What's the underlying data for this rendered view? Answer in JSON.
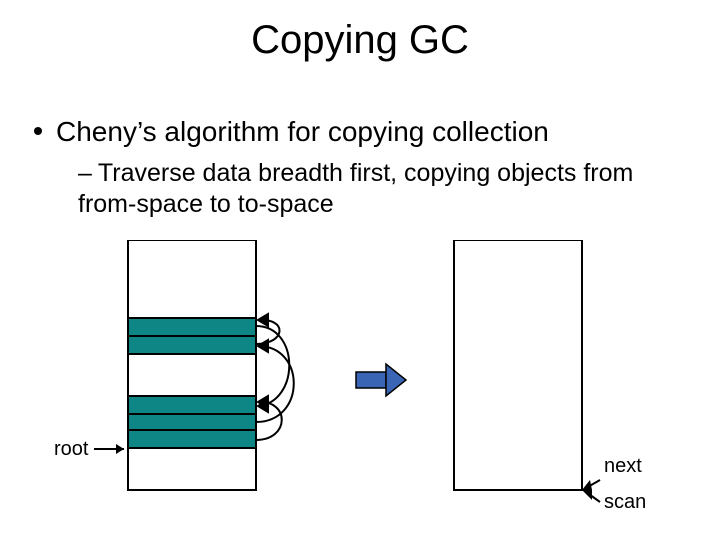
{
  "title": "Copying GC",
  "bullet_main": "Cheny’s algorithm for copying collection",
  "bullet_sub": "Traverse data breadth first, copying objects from from-space to to-space",
  "labels": {
    "root": "root",
    "next": "next",
    "scan": "scan"
  },
  "colors": {
    "fill": "#0f8686",
    "arrow": "#3a64b4"
  }
}
